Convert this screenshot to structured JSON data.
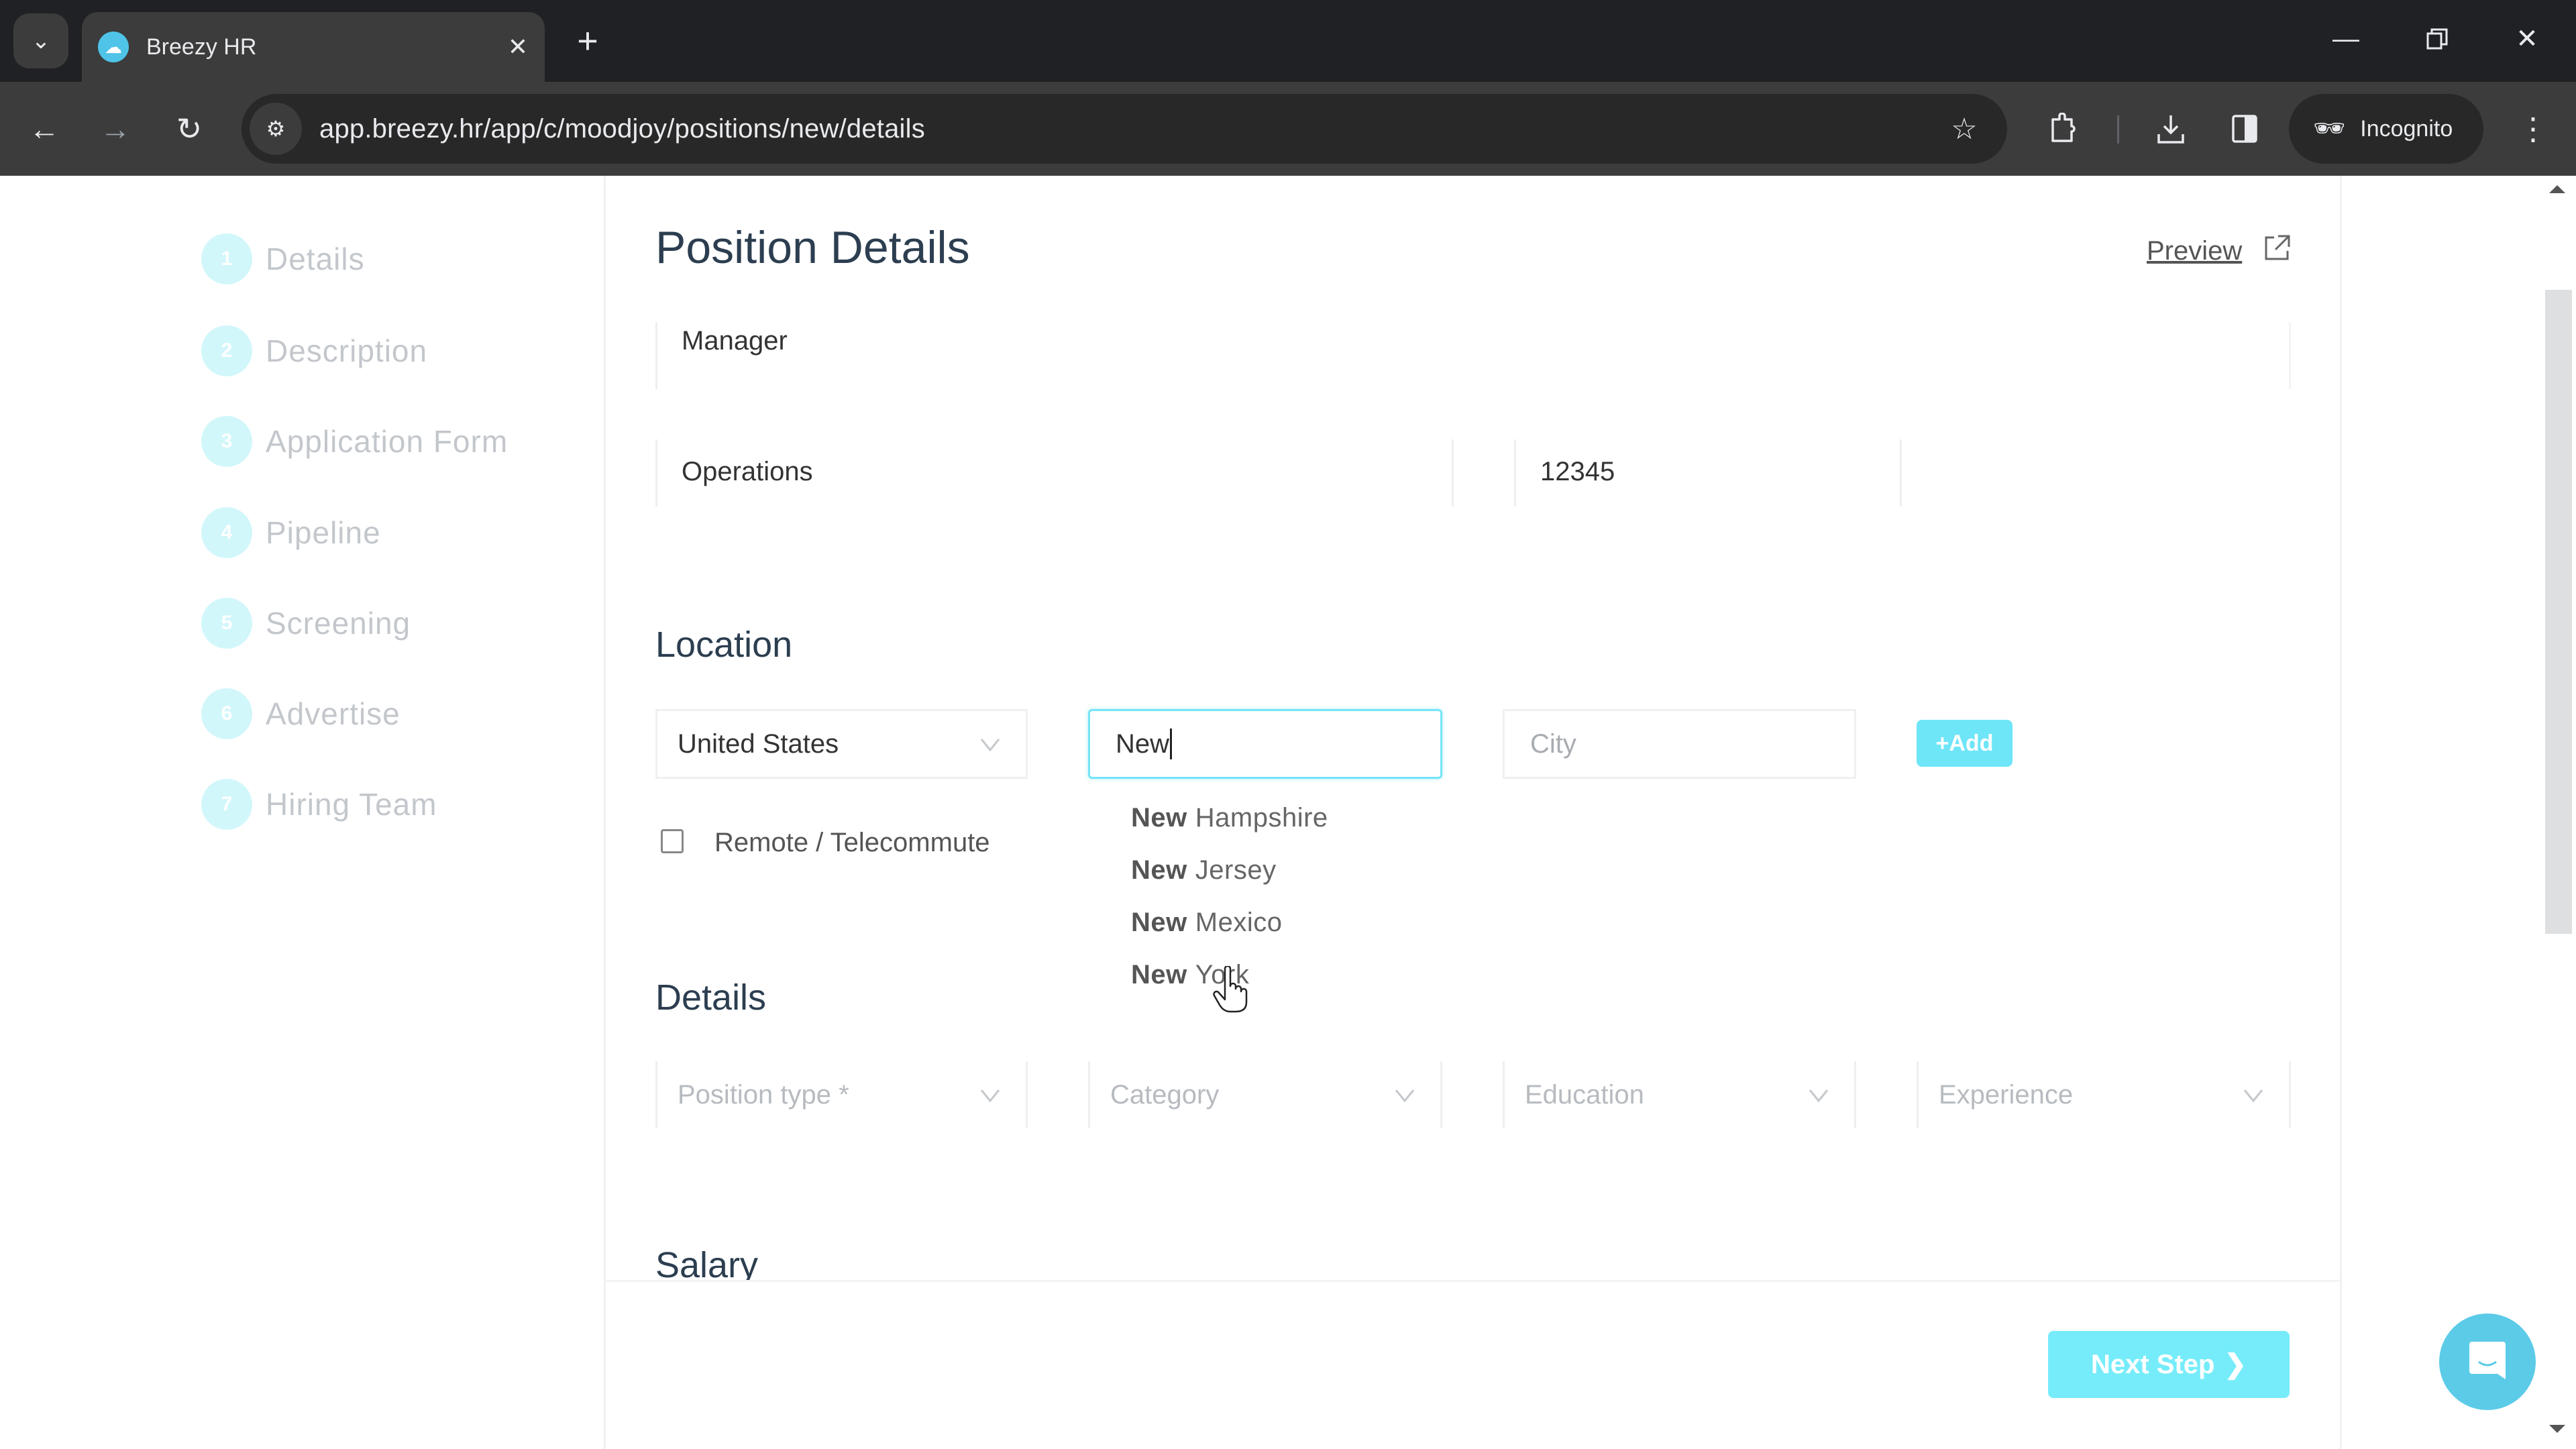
{
  "browser": {
    "tab_title": "Breezy HR",
    "url": "app.breezy.hr/app/c/moodjoy/positions/new/details",
    "incognito_label": "Incognito",
    "icons": {
      "tab_search": "chevron-down-icon",
      "favicon": "breezy-cloud-icon",
      "close_tab": "close-icon",
      "new_tab": "plus-icon",
      "minimize": "minimize-icon",
      "restore": "restore-icon",
      "close_window": "close-icon",
      "back": "arrow-left-icon",
      "forward": "arrow-right-icon",
      "reload": "reload-icon",
      "site_info": "tune-icon",
      "bookmark": "star-icon",
      "extensions": "puzzle-icon",
      "downloads": "download-icon",
      "side_panel": "side-panel-icon",
      "incognito": "incognito-icon",
      "menu": "more-vert-icon"
    }
  },
  "sidebar": {
    "steps": [
      {
        "number": "1",
        "label": "Details"
      },
      {
        "number": "2",
        "label": "Description"
      },
      {
        "number": "3",
        "label": "Application Form"
      },
      {
        "number": "4",
        "label": "Pipeline"
      },
      {
        "number": "5",
        "label": "Screening"
      },
      {
        "number": "6",
        "label": "Advertise"
      },
      {
        "number": "7",
        "label": "Hiring Team"
      }
    ]
  },
  "main": {
    "title": "Position Details",
    "preview_label": "Preview",
    "fields": {
      "position_title": "Manager",
      "department": "Operations",
      "requisition_code": "12345"
    },
    "location": {
      "heading": "Location",
      "country": "United States",
      "state_value": "New",
      "city_placeholder": "City",
      "add_label": "+Add",
      "remote_label": "Remote / Telecommute",
      "remote_checked": false,
      "suggestions": [
        {
          "match": "New",
          "rest": "Hampshire"
        },
        {
          "match": "New",
          "rest": "Jersey"
        },
        {
          "match": "New",
          "rest": "Mexico"
        },
        {
          "match": "New",
          "rest": "York"
        }
      ]
    },
    "details": {
      "heading": "Details",
      "selects": [
        {
          "placeholder": "Position type *"
        },
        {
          "placeholder": "Category"
        },
        {
          "placeholder": "Education"
        },
        {
          "placeholder": "Experience"
        }
      ]
    },
    "salary": {
      "heading": "Salary"
    },
    "next_step_label": "Next Step"
  },
  "colors": {
    "accent": "#76ecfa",
    "step_circle": "#d2f7fb",
    "chat_widget": "#5bcbe8",
    "heading": "#2c3e50"
  }
}
